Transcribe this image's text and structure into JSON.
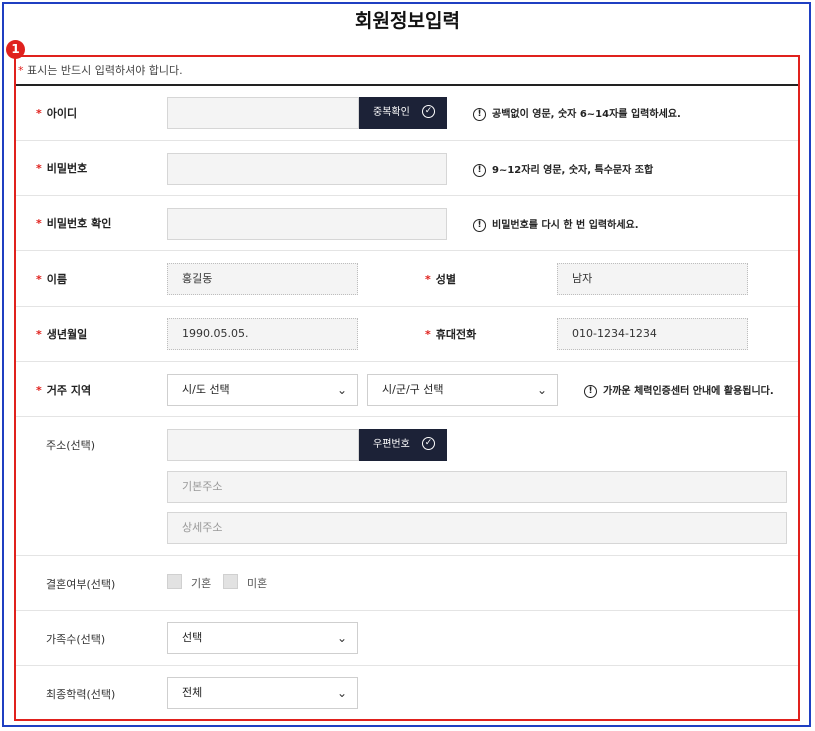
{
  "title": "회원정보입력",
  "badge": "1",
  "notice": {
    "star": "*",
    "text": " 표시는 반드시 입력하셔야 합니다."
  },
  "required_mark": "*",
  "fields": {
    "id": {
      "label": "아이디",
      "value": "",
      "button": "중복확인",
      "hint": "공백없이 영문, 숫자 6~14자를 입력하세요."
    },
    "password": {
      "label": "비밀번호",
      "value": "",
      "hint": "9~12자리 영문, 숫자, 특수문자 조합"
    },
    "password_confirm": {
      "label": "비밀번호 확인",
      "value": "",
      "hint": "비밀번호를 다시 한 번 입력하세요."
    },
    "name": {
      "label": "이름",
      "value": "홍길동"
    },
    "gender": {
      "label": "성별",
      "value": "남자"
    },
    "birth": {
      "label": "생년월일",
      "value": "1990.05.05."
    },
    "phone": {
      "label": "휴대전화",
      "value": "010-1234-1234"
    },
    "region": {
      "label": "거주 지역",
      "province": "시/도 선택",
      "city": "시/군/구 선택",
      "hint": "가까운 체력인증센터 안내에 활용됩니다."
    },
    "address": {
      "label": "주소(선택)",
      "postcode_button": "우편번호",
      "basic_placeholder": "기본주소",
      "detail_placeholder": "상세주소"
    },
    "marital": {
      "label": "결혼여부(선택)",
      "options": [
        "기혼",
        "미혼"
      ]
    },
    "family": {
      "label": "가족수(선택)",
      "value": "선택"
    },
    "education": {
      "label": "최종학력(선택)",
      "value": "전체"
    }
  },
  "icons": {
    "info": "info-circle-icon",
    "check": "check-circle-icon",
    "chevron": "chevron-down-icon"
  },
  "colors": {
    "accent_red": "#e0211d",
    "frame_blue": "#1f3fc2",
    "dark_button": "#1c2237"
  }
}
